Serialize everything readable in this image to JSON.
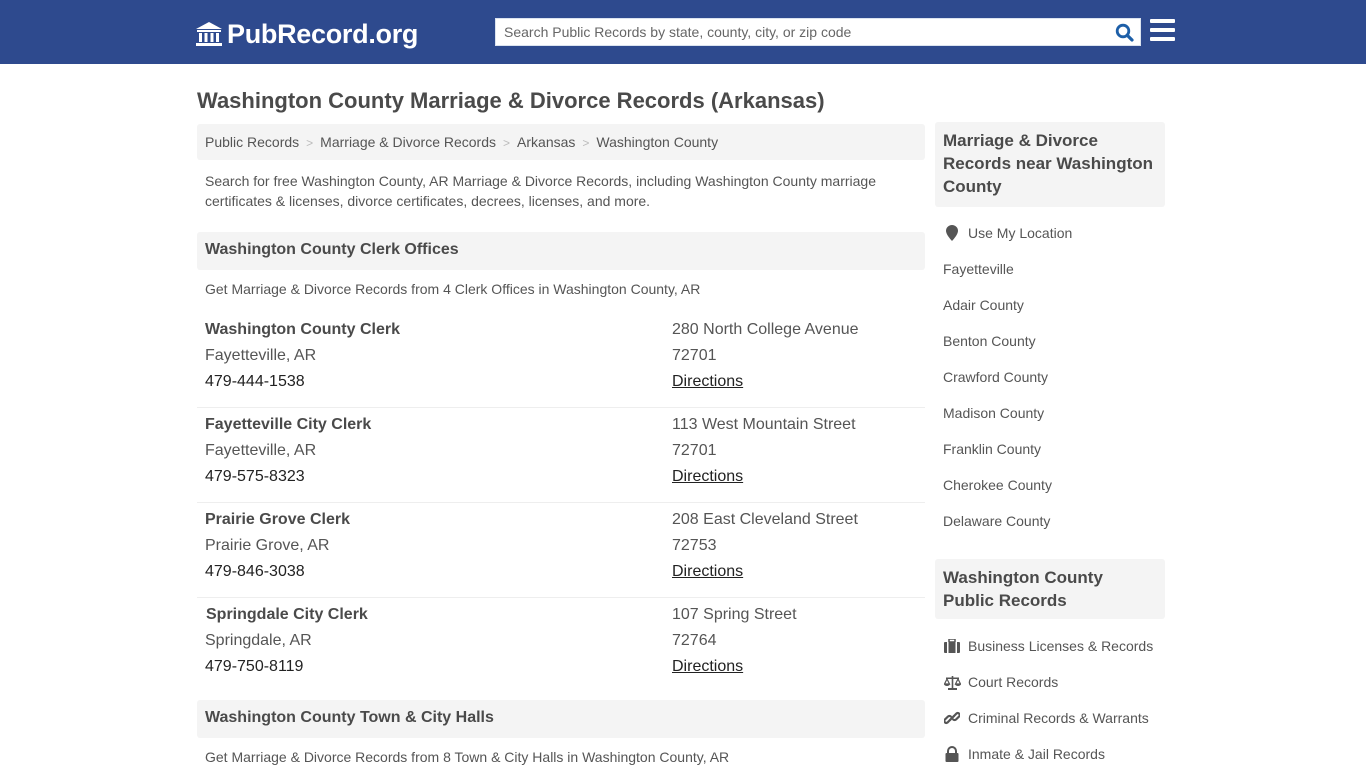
{
  "header": {
    "logo_text": "PubRecord.org",
    "search_placeholder": "Search Public Records by state, county, city, or zip code",
    "search_value": "",
    "brand_color": "#2e4a8e",
    "icons": [
      "courthouse-icon",
      "search-icon",
      "hamburger-menu-icon"
    ]
  },
  "page": {
    "title": "Washington County Marriage & Divorce Records (Arkansas)",
    "breadcrumb": [
      {
        "label": "Public Records"
      },
      {
        "label": "Marriage & Divorce Records"
      },
      {
        "label": "Arkansas"
      },
      {
        "label": "Washington County"
      }
    ],
    "breadcrumb_separator": ">",
    "intro": "Search for free Washington County, AR Marriage & Divorce Records, including Washington County marriage certificates & licenses, divorce certificates, decrees, licenses, and more."
  },
  "clerk_section": {
    "heading": "Washington County Clerk Offices",
    "subtitle": "Get Marriage & Divorce Records from 4 Clerk Offices in Washington County, AR",
    "offices": [
      {
        "name": "Washington County Clerk",
        "city": "Fayetteville, AR",
        "phone": "479-444-1538",
        "address": "280 North College Avenue",
        "zip": "72701",
        "directions": "Directions"
      },
      {
        "name": "Fayetteville City Clerk",
        "city": "Fayetteville, AR",
        "phone": "479-575-8323",
        "address": "113 West Mountain Street",
        "zip": "72701",
        "directions": "Directions"
      },
      {
        "name": "Prairie Grove Clerk",
        "city": "Prairie Grove, AR",
        "phone": "479-846-3038",
        "address": "208 East Cleveland Street",
        "zip": "72753",
        "directions": "Directions"
      },
      {
        "name": "Springdale City Clerk",
        "city": "Springdale, AR",
        "phone": "479-750-8119",
        "address": "107 Spring Street",
        "zip": "72764",
        "directions": "Directions"
      }
    ]
  },
  "hall_section": {
    "heading": "Washington County Town & City Halls",
    "subtitle": "Get Marriage & Divorce Records from 8 Town & City Halls in Washington County, AR"
  },
  "sidebar": {
    "nearby": {
      "heading": "Marriage & Divorce Records near Washington County",
      "use_location": "Use My Location",
      "items": [
        "Fayetteville",
        "Adair County",
        "Benton County",
        "Crawford County",
        "Madison County",
        "Franklin County",
        "Cherokee County",
        "Delaware County"
      ]
    },
    "public_records": {
      "heading": "Washington County Public Records",
      "items": [
        {
          "label": "Business Licenses & Records",
          "icon": "briefcase-icon"
        },
        {
          "label": "Court Records",
          "icon": "scales-icon"
        },
        {
          "label": "Criminal Records & Warrants",
          "icon": "link-icon"
        },
        {
          "label": "Inmate & Jail Records",
          "icon": "lock-icon"
        }
      ]
    }
  }
}
